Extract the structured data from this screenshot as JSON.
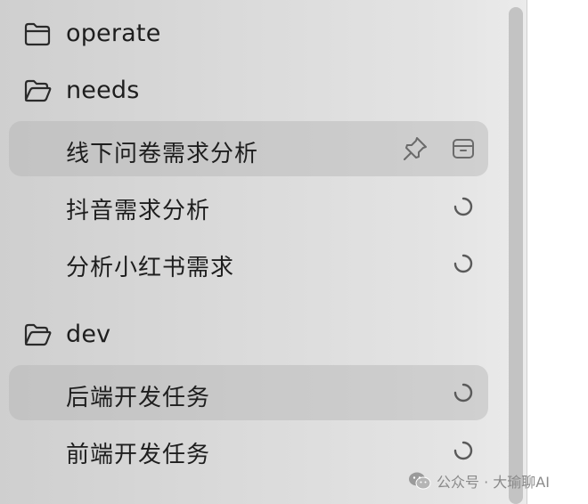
{
  "sidebar": {
    "groups": [
      {
        "name": "operate",
        "icon": "folder-icon",
        "expanded": false,
        "tasks": []
      },
      {
        "name": "needs",
        "icon": "folder-open-icon",
        "expanded": true,
        "tasks": [
          {
            "label": "线下问卷需求分析",
            "selected": true,
            "actions": [
              "pin-icon",
              "archive-icon"
            ]
          },
          {
            "label": "抖音需求分析",
            "status_icon": "loading-spinner-icon"
          },
          {
            "label": "分析小红书需求",
            "status_icon": "loading-spinner-icon"
          }
        ]
      },
      {
        "name": "dev",
        "icon": "folder-open-icon",
        "expanded": true,
        "tasks": [
          {
            "label": "后端开发任务",
            "selected": true,
            "status_icon": "loading-spinner-icon"
          },
          {
            "label": "前端开发任务",
            "status_icon": "loading-spinner-icon"
          }
        ]
      }
    ]
  },
  "watermark": {
    "icon": "wechat-icon",
    "text": "公众号 · 大瑜聊AI"
  },
  "colors": {
    "selected_row": "#c8c8c8",
    "text": "#1e1e1e",
    "icon": "#6b6b6b",
    "watermark_text": "#8a8a8a"
  }
}
